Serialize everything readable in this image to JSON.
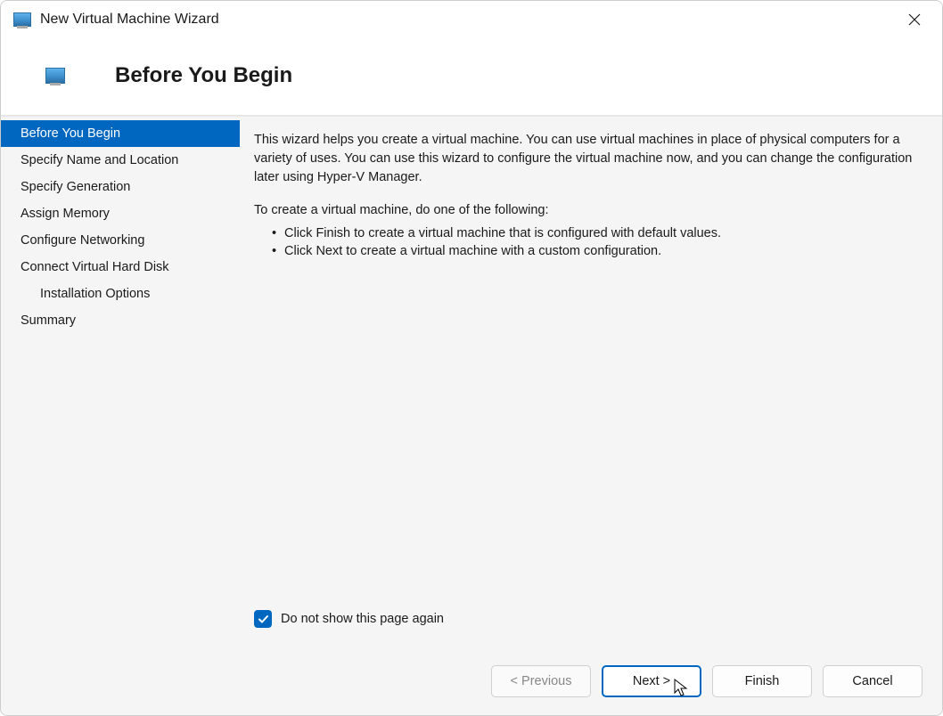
{
  "window": {
    "title": "New Virtual Machine Wizard"
  },
  "header": {
    "title": "Before You Begin"
  },
  "sidebar": {
    "items": [
      {
        "label": "Before You Begin",
        "active": true,
        "indented": false
      },
      {
        "label": "Specify Name and Location",
        "active": false,
        "indented": false
      },
      {
        "label": "Specify Generation",
        "active": false,
        "indented": false
      },
      {
        "label": "Assign Memory",
        "active": false,
        "indented": false
      },
      {
        "label": "Configure Networking",
        "active": false,
        "indented": false
      },
      {
        "label": "Connect Virtual Hard Disk",
        "active": false,
        "indented": false
      },
      {
        "label": "Installation Options",
        "active": false,
        "indented": true
      },
      {
        "label": "Summary",
        "active": false,
        "indented": false
      }
    ]
  },
  "main": {
    "description": "This wizard helps you create a virtual machine. You can use virtual machines in place of physical computers for a variety of uses. You can use this wizard to configure the virtual machine now, and you can change the configuration later using Hyper-V Manager.",
    "instruction": "To create a virtual machine, do one of the following:",
    "bullets": [
      "Click Finish to create a virtual machine that is configured with default values.",
      "Click Next to create a virtual machine with a custom configuration."
    ],
    "checkbox": {
      "checked": true,
      "label": "Do not show this page again"
    }
  },
  "buttons": {
    "previous": "< Previous",
    "next": "Next >",
    "finish": "Finish",
    "cancel": "Cancel"
  }
}
